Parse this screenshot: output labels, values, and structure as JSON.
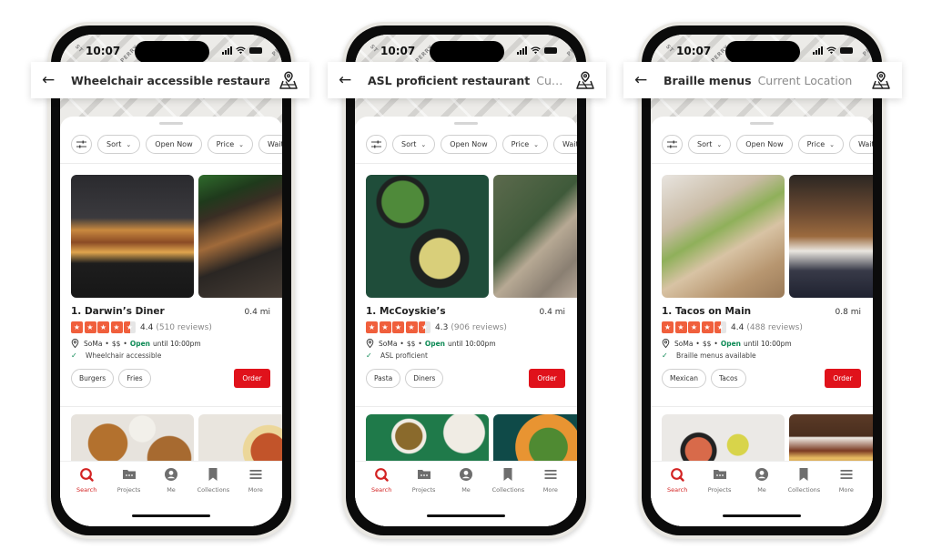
{
  "status_bar": {
    "time": "10:07"
  },
  "map_labels": [
    "ST",
    "PERRY",
    "ST",
    "PER"
  ],
  "filters": {
    "items": [
      {
        "label": "Sort",
        "dropdown": true
      },
      {
        "label": "Open Now",
        "dropdown": false
      },
      {
        "label": "Price",
        "dropdown": true
      },
      {
        "label": "Waitlist",
        "dropdown": false
      }
    ]
  },
  "tabbar": {
    "items": [
      {
        "label": "Search",
        "icon": "search-icon",
        "active": true
      },
      {
        "label": "Projects",
        "icon": "projects-icon",
        "active": false
      },
      {
        "label": "Me",
        "icon": "profile-icon",
        "active": false
      },
      {
        "label": "Collections",
        "icon": "bookmark-icon",
        "active": false
      },
      {
        "label": "More",
        "icon": "menu-icon",
        "active": false
      }
    ]
  },
  "colors": {
    "brand_red": "#e0121b",
    "star_orange": "#f05f3c",
    "open_green": "#0d8a55",
    "active_tab": "#d32323"
  },
  "phones": [
    {
      "search": {
        "query": "Wheelchair accessible restaurant",
        "location": ""
      },
      "result": {
        "name": "1. Darwin’s Diner",
        "distance": "0.4 mi",
        "rating": 4.4,
        "rating_text": "4.4",
        "reviews": "(510 reviews)",
        "neighborhood": "SoMa",
        "price": "$$",
        "open_label": "Open",
        "hours": "until 10:00pm",
        "amenity": "Wheelchair accessible",
        "tags": [
          "Burgers",
          "Fries"
        ],
        "order_label": "Order",
        "photos": [
          "burgers-and-fries",
          "restaurant-patio-night"
        ]
      },
      "next_photos": [
        "fried-chicken-plate",
        "tacos-plate"
      ]
    },
    {
      "search": {
        "query": "ASL proficient restaurant",
        "location": "Curr..."
      },
      "result": {
        "name": "1. McCoyskie’s",
        "distance": "0.4 mi",
        "rating": 4.3,
        "rating_text": "4.3",
        "reviews": "(906 reviews)",
        "neighborhood": "SoMa",
        "price": "$$",
        "open_label": "Open",
        "hours": "until 10:00pm",
        "amenity": "ASL proficient",
        "tags": [
          "Pasta",
          "Diners"
        ],
        "order_label": "Order",
        "photos": [
          "ravioli-and-greens",
          "diners-aerial-view"
        ]
      },
      "next_photos": [
        "tacos-table-green",
        "green-beans-orange-plate"
      ]
    },
    {
      "search": {
        "query": "Braille menus",
        "location": "Current Location"
      },
      "result": {
        "name": "1. Tacos on Main",
        "distance": "0.8 mi",
        "rating": 4.4,
        "rating_text": "4.4",
        "reviews": "(488 reviews)",
        "neighborhood": "SoMa",
        "price": "$$",
        "open_label": "Open",
        "hours": "until 10:00pm",
        "amenity": "Braille menus available",
        "tags": [
          "Mexican",
          "Tacos"
        ],
        "order_label": "Order",
        "photos": [
          "tacos-closeup",
          "bar-shelves"
        ]
      },
      "next_photos": [
        "table-spread-wine",
        "bbq-tray"
      ]
    }
  ]
}
